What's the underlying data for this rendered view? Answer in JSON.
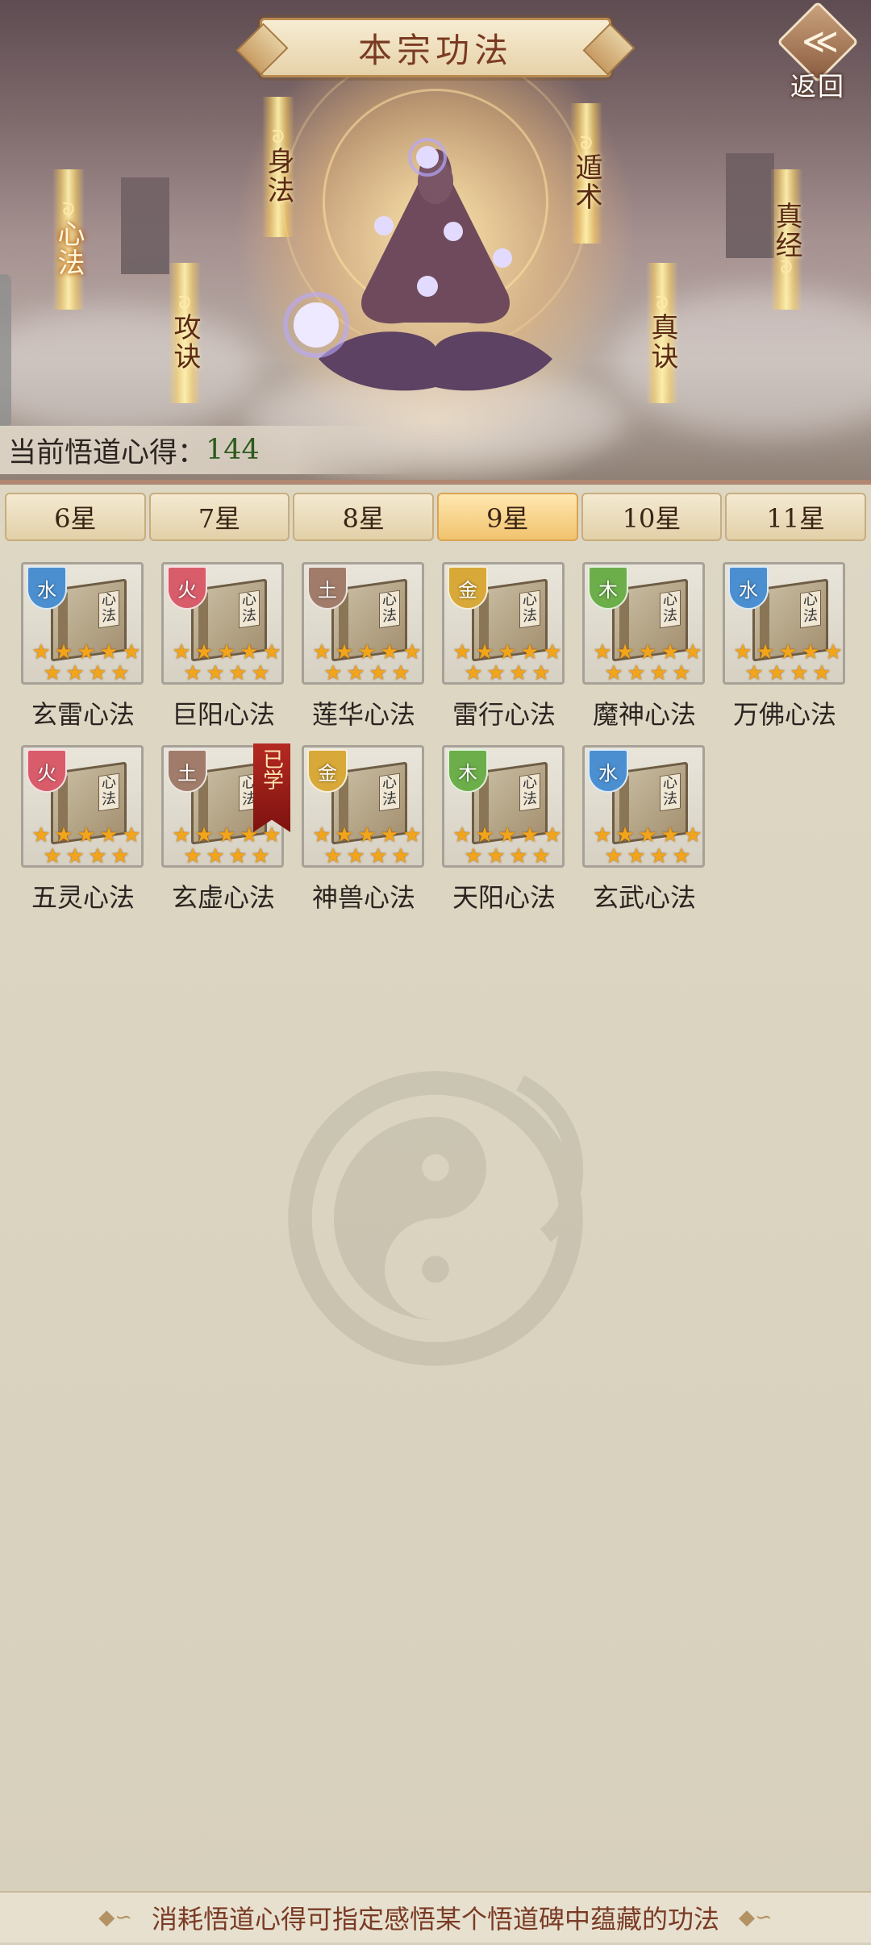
{
  "header": {
    "title": "本宗功法",
    "back_label": "返回",
    "back_glyph": "≪"
  },
  "pillars": [
    {
      "label": "心法",
      "active": true
    },
    {
      "label": "攻诀",
      "active": false
    },
    {
      "label": "身法",
      "active": false
    },
    {
      "label": "遁术",
      "active": false
    },
    {
      "label": "真诀",
      "active": false
    },
    {
      "label": "真经",
      "active": false
    }
  ],
  "insight": {
    "label": "当前悟道心得：",
    "value": "144"
  },
  "tabs": [
    "6星",
    "7星",
    "8星",
    "9星",
    "10星",
    "11星"
  ],
  "active_tab": "9星",
  "techniques": [
    {
      "name": "玄雷心法",
      "element": "水",
      "color": "#4b8fd0",
      "stars": 9,
      "learned": false
    },
    {
      "name": "巨阳心法",
      "element": "火",
      "color": "#d85c6a",
      "stars": 9,
      "learned": false
    },
    {
      "name": "莲华心法",
      "element": "土",
      "color": "#a27c6a",
      "stars": 9,
      "learned": false
    },
    {
      "name": "雷行心法",
      "element": "金",
      "color": "#d8a838",
      "stars": 9,
      "learned": false
    },
    {
      "name": "魔神心法",
      "element": "木",
      "color": "#6cae4a",
      "stars": 9,
      "learned": false
    },
    {
      "name": "万佛心法",
      "element": "水",
      "color": "#4b8fd0",
      "stars": 9,
      "learned": false
    },
    {
      "name": "五灵心法",
      "element": "火",
      "color": "#d85c6a",
      "stars": 9,
      "learned": false
    },
    {
      "name": "玄虚心法",
      "element": "土",
      "color": "#a27c6a",
      "stars": 9,
      "learned": true
    },
    {
      "name": "神兽心法",
      "element": "金",
      "color": "#d8a838",
      "stars": 9,
      "learned": false
    },
    {
      "name": "天阳心法",
      "element": "木",
      "color": "#6cae4a",
      "stars": 9,
      "learned": false
    },
    {
      "name": "玄武心法",
      "element": "水",
      "color": "#4b8fd0",
      "stars": 9,
      "learned": false
    }
  ],
  "learned_label": "已学",
  "book_tag": "心法",
  "footer": {
    "text": "消耗悟道心得可指定感悟某个悟道碑中蕴藏的功法",
    "ornament": "◆∽"
  }
}
